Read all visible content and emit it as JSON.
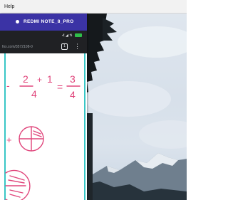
{
  "menubar": {
    "help_label": "Help"
  },
  "phone": {
    "device_name": "REDMI NOTE_8_PRO",
    "status_icons": "⊀ ◢ ⇅",
    "url_text": "fox.com/3572108-0",
    "tabs_count": "1",
    "more_glyph": "⋮"
  },
  "handwriting": {
    "color": "#e0457b",
    "equation_prefix": "-",
    "fraction1_num": "2",
    "plus": "+",
    "fraction2_num": "1",
    "fraction_den": "4",
    "equals": "=",
    "result_num": "3",
    "result_den": "4",
    "plus_sign_2": "+"
  },
  "colors": {
    "titlebar": "#3b33a5",
    "accent_line": "#38c6c6"
  }
}
